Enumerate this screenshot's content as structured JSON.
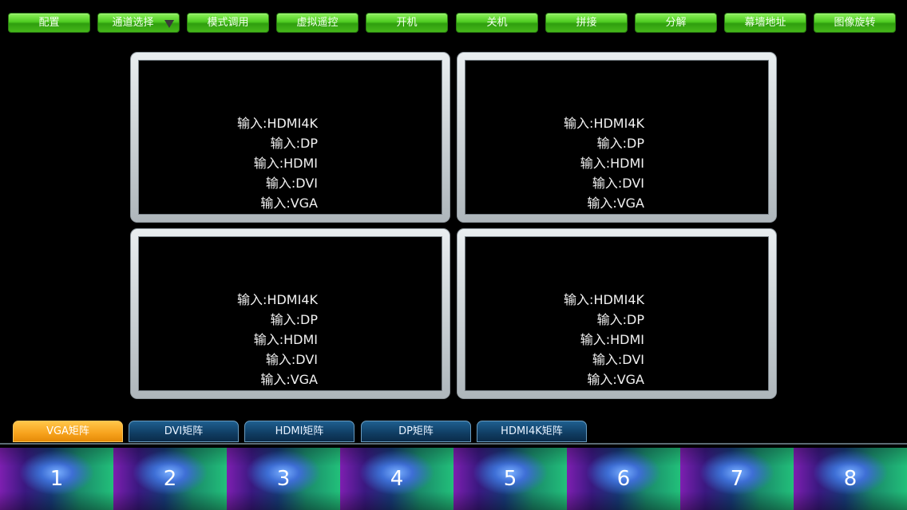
{
  "toolbar": {
    "buttons": [
      {
        "label": "配置"
      },
      {
        "label": "通道选择",
        "dropdown": true
      },
      {
        "label": "模式调用"
      },
      {
        "label": "虚拟遥控"
      },
      {
        "label": "开机"
      },
      {
        "label": "关机"
      },
      {
        "label": "拼接"
      },
      {
        "label": "分解"
      },
      {
        "label": "幕墙地址"
      },
      {
        "label": "图像旋转"
      }
    ]
  },
  "screens": [
    {
      "inputs": [
        "输入:HDMI4K",
        "输入:DP",
        "输入:HDMI",
        "输入:DVI",
        "输入:VGA"
      ]
    },
    {
      "inputs": [
        "输入:HDMI4K",
        "输入:DP",
        "输入:HDMI",
        "输入:DVI",
        "输入:VGA"
      ]
    },
    {
      "inputs": [
        "输入:HDMI4K",
        "输入:DP",
        "输入:HDMI",
        "输入:DVI",
        "输入:VGA"
      ]
    },
    {
      "inputs": [
        "输入:HDMI4K",
        "输入:DP",
        "输入:HDMI",
        "输入:DVI",
        "输入:VGA"
      ]
    }
  ],
  "matrix_tabs": [
    {
      "label": "VGA矩阵",
      "active": true
    },
    {
      "label": "DVI矩阵",
      "active": false
    },
    {
      "label": "HDMI矩阵",
      "active": false
    },
    {
      "label": "DP矩阵",
      "active": false
    },
    {
      "label": "HDMI4K矩阵",
      "active": false
    }
  ],
  "channels": [
    "1",
    "2",
    "3",
    "4",
    "5",
    "6",
    "7",
    "8"
  ],
  "colors": {
    "button_green": "#4fcc22",
    "tab_active": "#f7a21c",
    "tab_inactive": "#103d62",
    "screen_frame": "#c9d0d4"
  }
}
